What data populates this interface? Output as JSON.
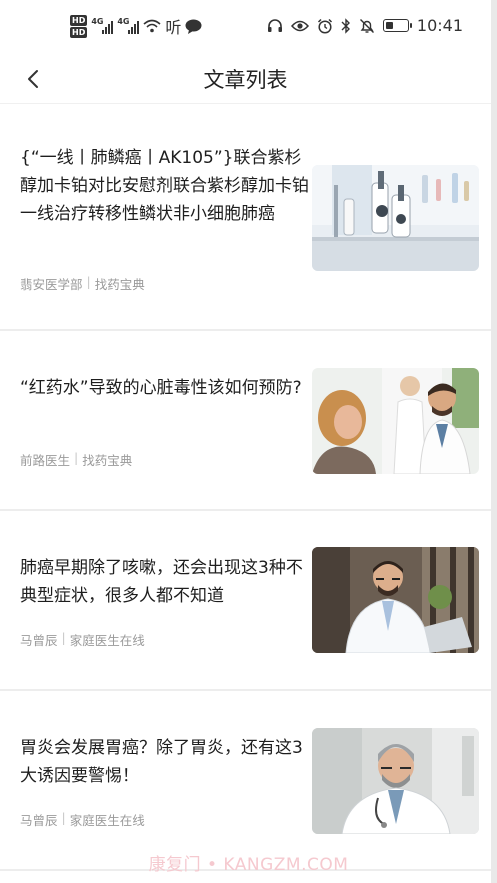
{
  "status_bar": {
    "hd1": "HD",
    "hd2": "HD",
    "net1": "4G",
    "net2": "4G",
    "extra_glyph": "听",
    "battery_level": 0.4,
    "time": "10:41",
    "icons": [
      "wifi-icon",
      "chat-bubble-icon",
      "headset-icon",
      "eye-icon",
      "alarm-icon",
      "bluetooth-icon",
      "mute-bell-icon",
      "battery-icon"
    ]
  },
  "header": {
    "title": "文章列表",
    "back_icon": "chevron-left-icon"
  },
  "articles": [
    {
      "title": "{“一线丨肺鳞癌丨AK105”}联合紫杉醇加卡铂对比安慰剂联合紫杉醇加卡铂一线治疗转移性鳞状非小细胞肺癌",
      "author": "翡安医学部",
      "source": "找药宝典",
      "image": "laboratory-microscopes-photo"
    },
    {
      "title": "“红药水”导致的心脏毒性该如何预防?",
      "author": "前路医生",
      "source": "找药宝典",
      "image": "doctor-talking-with-elderly-patient-photo"
    },
    {
      "title": "肺癌早期除了咳嗽，还会出现这3种不典型症状，很多人都不知道",
      "author": "马曾辰",
      "source": "家庭医生在线",
      "image": "smiling-doctor-at-laptop-photo"
    },
    {
      "title": "胃炎会发展胃癌？除了胃炎，还有这3大诱因要警惕！",
      "author": "马曾辰",
      "source": "家庭医生在线",
      "image": "senior-doctor-portrait-photo"
    }
  ],
  "watermark": "康复门 • KANGZM.COM"
}
